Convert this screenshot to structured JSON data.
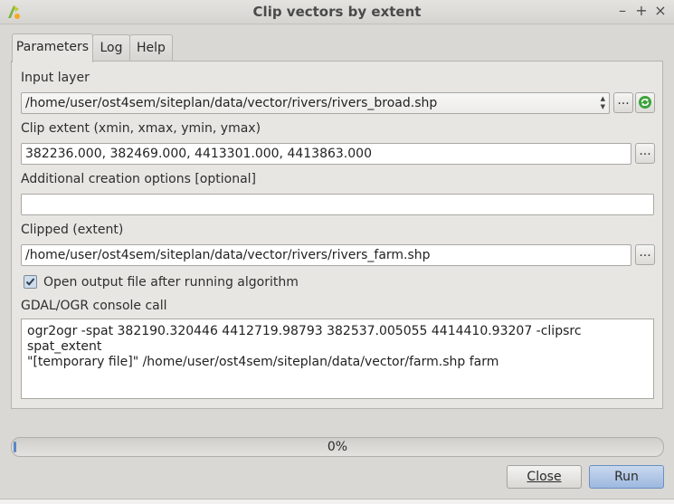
{
  "window": {
    "title": "Clip vectors by extent"
  },
  "tabs": [
    {
      "label": "Parameters",
      "active": true
    },
    {
      "label": "Log",
      "active": false
    },
    {
      "label": "Help",
      "active": false
    }
  ],
  "input_layer": {
    "label": "Input layer",
    "value": "/home/user/ost4sem/siteplan/data/vector/rivers/rivers_broad.shp",
    "browse_label": "..."
  },
  "clip_extent": {
    "label": "Clip extent (xmin, xmax, ymin, ymax)",
    "value": "382236.000, 382469.000, 4413301.000, 4413863.000",
    "browse_label": "..."
  },
  "creation_options": {
    "label": "Additional creation options [optional]",
    "value": ""
  },
  "clipped": {
    "label": "Clipped (extent)",
    "value": "/home/user/ost4sem/siteplan/data/vector/rivers/rivers_farm.shp",
    "browse_label": "..."
  },
  "open_output": {
    "label": "Open output file after running algorithm",
    "checked": true
  },
  "console": {
    "label": "GDAL/OGR console call",
    "line1": "ogr2ogr -spat 382190.320446 4412719.98793 382537.005055 4414410.93207 -clipsrc spat_extent",
    "line2": "\"[temporary file]\" /home/user/ost4sem/siteplan/data/vector/farm.shp farm"
  },
  "progress": {
    "text": "0%",
    "value": 0
  },
  "buttons": {
    "close": "Close",
    "run": "Run"
  },
  "window_controls": {
    "minimize": "–",
    "maximize": "+",
    "close": "×"
  },
  "colors": {
    "accent": "#9db8df",
    "progress_fill": "#5a86c8",
    "iterate_icon": "#3aa33a"
  }
}
